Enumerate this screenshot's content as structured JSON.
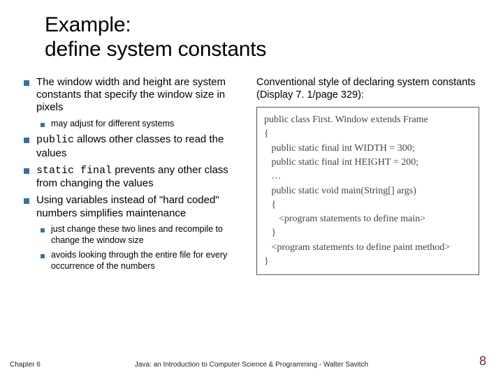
{
  "title": {
    "line1": "Example:",
    "line2": "define system constants"
  },
  "left": {
    "b1": "The window width and height are system constants that specify the window size in pixels",
    "b1_sub1": "may adjust for different systems",
    "b2_pre": "public",
    "b2_rest": " allows other classes to read the values",
    "b3_pre": "static final",
    "b3_rest": " prevents any other class from changing the values",
    "b4": "Using variables instead of \"hard coded\" numbers simplifies maintenance",
    "b4_sub1": "just change these two lines and recompile to change the window size",
    "b4_sub2": "avoids looking through the entire file for every occurrence of the numbers"
  },
  "right": {
    "intro": "Conventional style of declaring system constants (Display 7. 1/page 329):",
    "code": {
      "l1": "public class First. Window extends Frame",
      "l2": "{",
      "l3": "   public static final int WIDTH = 300;",
      "l4": "   public static final int HEIGHT = 200;",
      "l5": "   …",
      "l6": "   public static void main(String[] args)",
      "l7": "   {",
      "l8": "      <program statements to define main>",
      "l9": "   }",
      "l10": "",
      "l11": "   <program statements to define paint method>",
      "l12": "",
      "l13": "}"
    }
  },
  "footer": {
    "chapter": "Chapter 6",
    "center": "Java: an Introduction to Computer Science & Programming - Walter Savitch",
    "page": "8"
  }
}
